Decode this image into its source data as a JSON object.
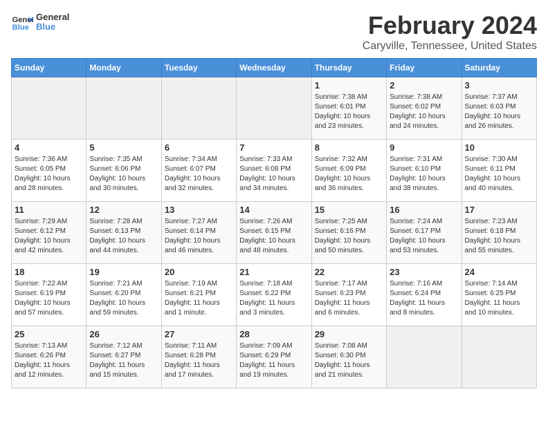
{
  "logo": {
    "text_general": "General",
    "text_blue": "Blue"
  },
  "header": {
    "title": "February 2024",
    "subtitle": "Caryville, Tennessee, United States"
  },
  "weekdays": [
    "Sunday",
    "Monday",
    "Tuesday",
    "Wednesday",
    "Thursday",
    "Friday",
    "Saturday"
  ],
  "weeks": [
    [
      {
        "day": "",
        "info": ""
      },
      {
        "day": "",
        "info": ""
      },
      {
        "day": "",
        "info": ""
      },
      {
        "day": "",
        "info": ""
      },
      {
        "day": "1",
        "info": "Sunrise: 7:38 AM\nSunset: 6:01 PM\nDaylight: 10 hours\nand 23 minutes."
      },
      {
        "day": "2",
        "info": "Sunrise: 7:38 AM\nSunset: 6:02 PM\nDaylight: 10 hours\nand 24 minutes."
      },
      {
        "day": "3",
        "info": "Sunrise: 7:37 AM\nSunset: 6:03 PM\nDaylight: 10 hours\nand 26 minutes."
      }
    ],
    [
      {
        "day": "4",
        "info": "Sunrise: 7:36 AM\nSunset: 6:05 PM\nDaylight: 10 hours\nand 28 minutes."
      },
      {
        "day": "5",
        "info": "Sunrise: 7:35 AM\nSunset: 6:06 PM\nDaylight: 10 hours\nand 30 minutes."
      },
      {
        "day": "6",
        "info": "Sunrise: 7:34 AM\nSunset: 6:07 PM\nDaylight: 10 hours\nand 32 minutes."
      },
      {
        "day": "7",
        "info": "Sunrise: 7:33 AM\nSunset: 6:08 PM\nDaylight: 10 hours\nand 34 minutes."
      },
      {
        "day": "8",
        "info": "Sunrise: 7:32 AM\nSunset: 6:09 PM\nDaylight: 10 hours\nand 36 minutes."
      },
      {
        "day": "9",
        "info": "Sunrise: 7:31 AM\nSunset: 6:10 PM\nDaylight: 10 hours\nand 38 minutes."
      },
      {
        "day": "10",
        "info": "Sunrise: 7:30 AM\nSunset: 6:11 PM\nDaylight: 10 hours\nand 40 minutes."
      }
    ],
    [
      {
        "day": "11",
        "info": "Sunrise: 7:29 AM\nSunset: 6:12 PM\nDaylight: 10 hours\nand 42 minutes."
      },
      {
        "day": "12",
        "info": "Sunrise: 7:28 AM\nSunset: 6:13 PM\nDaylight: 10 hours\nand 44 minutes."
      },
      {
        "day": "13",
        "info": "Sunrise: 7:27 AM\nSunset: 6:14 PM\nDaylight: 10 hours\nand 46 minutes."
      },
      {
        "day": "14",
        "info": "Sunrise: 7:26 AM\nSunset: 6:15 PM\nDaylight: 10 hours\nand 48 minutes."
      },
      {
        "day": "15",
        "info": "Sunrise: 7:25 AM\nSunset: 6:16 PM\nDaylight: 10 hours\nand 50 minutes."
      },
      {
        "day": "16",
        "info": "Sunrise: 7:24 AM\nSunset: 6:17 PM\nDaylight: 10 hours\nand 53 minutes."
      },
      {
        "day": "17",
        "info": "Sunrise: 7:23 AM\nSunset: 6:18 PM\nDaylight: 10 hours\nand 55 minutes."
      }
    ],
    [
      {
        "day": "18",
        "info": "Sunrise: 7:22 AM\nSunset: 6:19 PM\nDaylight: 10 hours\nand 57 minutes."
      },
      {
        "day": "19",
        "info": "Sunrise: 7:21 AM\nSunset: 6:20 PM\nDaylight: 10 hours\nand 59 minutes."
      },
      {
        "day": "20",
        "info": "Sunrise: 7:19 AM\nSunset: 6:21 PM\nDaylight: 11 hours\nand 1 minute."
      },
      {
        "day": "21",
        "info": "Sunrise: 7:18 AM\nSunset: 6:22 PM\nDaylight: 11 hours\nand 3 minutes."
      },
      {
        "day": "22",
        "info": "Sunrise: 7:17 AM\nSunset: 6:23 PM\nDaylight: 11 hours\nand 6 minutes."
      },
      {
        "day": "23",
        "info": "Sunrise: 7:16 AM\nSunset: 6:24 PM\nDaylight: 11 hours\nand 8 minutes."
      },
      {
        "day": "24",
        "info": "Sunrise: 7:14 AM\nSunset: 6:25 PM\nDaylight: 11 hours\nand 10 minutes."
      }
    ],
    [
      {
        "day": "25",
        "info": "Sunrise: 7:13 AM\nSunset: 6:26 PM\nDaylight: 11 hours\nand 12 minutes."
      },
      {
        "day": "26",
        "info": "Sunrise: 7:12 AM\nSunset: 6:27 PM\nDaylight: 11 hours\nand 15 minutes."
      },
      {
        "day": "27",
        "info": "Sunrise: 7:11 AM\nSunset: 6:28 PM\nDaylight: 11 hours\nand 17 minutes."
      },
      {
        "day": "28",
        "info": "Sunrise: 7:09 AM\nSunset: 6:29 PM\nDaylight: 11 hours\nand 19 minutes."
      },
      {
        "day": "29",
        "info": "Sunrise: 7:08 AM\nSunset: 6:30 PM\nDaylight: 11 hours\nand 21 minutes."
      },
      {
        "day": "",
        "info": ""
      },
      {
        "day": "",
        "info": ""
      }
    ]
  ]
}
